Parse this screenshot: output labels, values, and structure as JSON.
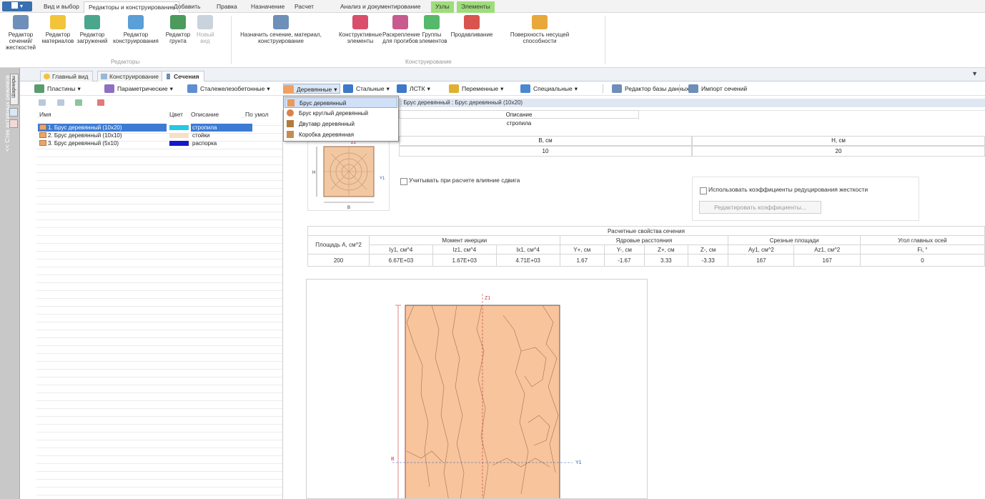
{
  "menu": {
    "app_button": "▾",
    "tabs": [
      "Вид и выбор",
      "Редакторы и конструирование",
      "Добавить",
      "Правка",
      "Назначение",
      "Расчет",
      "Анализ и документирование",
      "Узлы",
      "Элементы"
    ],
    "active_index": 1,
    "green_indexes": [
      7,
      8
    ]
  },
  "ribbon": {
    "buttons": [
      {
        "l1": "Редактор сечений/",
        "l2": "жесткостей",
        "icon": "section-editor-icon",
        "color": "#6d8fb8"
      },
      {
        "l1": "Редактор",
        "l2": "материалов",
        "icon": "material-icon",
        "color": "#f3c43a"
      },
      {
        "l1": "Редактор",
        "l2": "загружений",
        "icon": "load-editor-icon",
        "color": "#4aa68c"
      },
      {
        "l1": "Редактор",
        "l2": "конструирования",
        "icon": "design-editor-icon",
        "color": "#5a9fd6"
      },
      {
        "l1": "Редактор",
        "l2": "грунта",
        "icon": "soil-icon",
        "color": "#4c9a5c"
      },
      {
        "l1": "Новый",
        "l2": "вид",
        "icon": "new-view-icon",
        "color": "#c9d3de"
      },
      {
        "l1": "Назначить сечение, материал,",
        "l2": "конструирование",
        "icon": "assign-section-icon",
        "color": "#6d8fb8"
      },
      {
        "l1": "Конструктивные",
        "l2": "элементы",
        "icon": "structural-elements-icon",
        "color": "#d94f6b"
      },
      {
        "l1": "Раскрепление",
        "l2": "для прогибов",
        "icon": "bracing-icon",
        "color": "#c95a8e"
      },
      {
        "l1": "Группы",
        "l2": "элементов",
        "icon": "element-groups-icon",
        "color": "#56b86a"
      },
      {
        "l1": "Продавливание",
        "l2": "",
        "icon": "punching-icon",
        "color": "#d9534f"
      },
      {
        "l1": "Поверхность несущей",
        "l2": "способности",
        "icon": "capacity-surface-icon",
        "color": "#e8a83a"
      }
    ],
    "groups": [
      "Редакторы",
      "Конструирование"
    ]
  },
  "sidebar": {
    "label": "<< Стек активных режимов",
    "tab_label": "Шарниры"
  },
  "doc_tabs": [
    "Главный вид",
    "Конструирование",
    "Сечения"
  ],
  "toolbar": {
    "items": [
      "Пластины",
      "Параметрические",
      "Сталежелезобетонные",
      "Деревянные",
      "Стальные",
      "ЛСТК",
      "Переменные",
      "Специальные",
      "Редактор базы данных",
      "Импорт сечений"
    ],
    "arrow": "▾"
  },
  "list": {
    "headers": [
      "Имя",
      "Цвет",
      "Описание",
      "По умол"
    ],
    "rows": [
      {
        "name": "1. Брус деревянный (10x20)",
        "color": "#23c9e4",
        "desc": "стропила",
        "selected": true
      },
      {
        "name": "2. Брус деревянный (10x10)",
        "color": "#f7e0c4",
        "desc": "стойки",
        "selected": false
      },
      {
        "name": "3. Брус деревянный (5x10)",
        "color": "#1418c8",
        "desc": "распорка",
        "selected": false
      }
    ]
  },
  "dropdown": [
    "Брус деревянный",
    "Брус круглый деревянный",
    "Двутавр деревянный",
    "Коробка деревянная"
  ],
  "breadcrumb": ": Брус деревянный : Брус деревянный (10x20)",
  "description": {
    "header": "Описание",
    "value": "стропила"
  },
  "dims": {
    "b_label": "B, см",
    "b_value": "10",
    "h_label": "H, см",
    "h_value": "20"
  },
  "preview": {
    "z": "Z1",
    "y": "Y1",
    "b": "B",
    "h": "H"
  },
  "shear_check": "Учитывать при расчете влияние сдвига",
  "reduce_check": "Использовать коэффициенты редуцирования жесткости",
  "edit_coeffs": "Редактировать коэффициенты...",
  "props": {
    "title": "Расчетные свойства сечения",
    "area": "Площадь A, см^2",
    "inertia": "Момент инерции",
    "kern": "Ядровые расстояния",
    "shear": "Срезные площади",
    "angle": "Угол главных осей",
    "angle2": "Fi, °",
    "cols": [
      "Iy1, см^4",
      "Iz1, см^4",
      "Ix1, см^4",
      "Y+, см",
      "Y-, см",
      "Z+, см",
      "Z-, см",
      "Ay1, см^2",
      "Az1, см^2"
    ],
    "values": [
      "200",
      "6.67E+03",
      "1.67E+03",
      "4.71E+03",
      "1.67",
      "-1.67",
      "3.33",
      "-3.33",
      "167",
      "167",
      "0"
    ]
  },
  "canvas": {
    "z": "Z1",
    "y": "Y1",
    "b": "B"
  }
}
